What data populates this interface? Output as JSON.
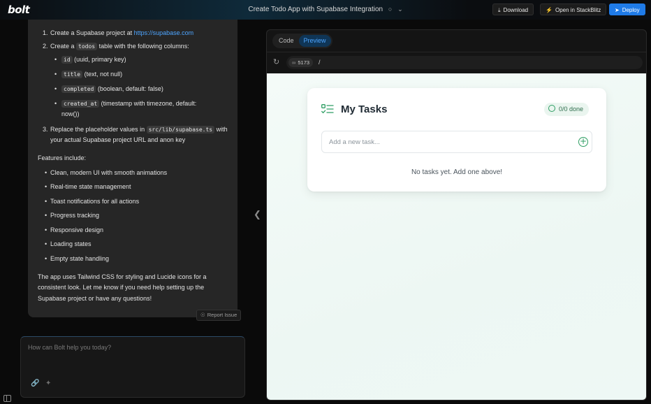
{
  "app": {
    "logo": "bolt",
    "project_title": "Create Todo App with Supabase Integration"
  },
  "toolbar": {
    "download": "Download",
    "stackblitz": "Open in StackBlitz",
    "deploy": "Deploy"
  },
  "chat": {
    "steps": [
      {
        "num": "1.",
        "pre": "Create a Supabase project at ",
        "link": "https://supabase.com"
      },
      {
        "num": "2.",
        "pre": "Create a ",
        "code": "todos",
        "post": " table with the following columns:"
      },
      {
        "num": "3.",
        "pre": "Replace the placeholder values in ",
        "code": "src/lib/supabase.ts",
        "post": " with your actual Supabase project URL and anon key"
      }
    ],
    "columns": [
      {
        "code": "id",
        "desc": " (uuid, primary key)"
      },
      {
        "code": "title",
        "desc": " (text, not null)"
      },
      {
        "code": "completed",
        "desc": " (boolean, default: false)"
      },
      {
        "code": "created_at",
        "desc": " (timestamp with timezone, default: now())"
      }
    ],
    "features_heading": "Features include:",
    "features": [
      "Clean, modern UI with smooth animations",
      "Real-time state management",
      "Toast notifications for all actions",
      "Progress tracking",
      "Responsive design",
      "Loading states",
      "Empty state handling"
    ],
    "closing": "The app uses Tailwind CSS for styling and Lucide icons for a consistent look. Let me know if you need help setting up the Supabase project or have any questions!",
    "report_issue": "Report Issue"
  },
  "prompt": {
    "placeholder": "How can Bolt help you today?"
  },
  "workbench": {
    "tabs": [
      {
        "label": "Code"
      },
      {
        "label": "Preview"
      }
    ],
    "port": "5173",
    "path": "/"
  },
  "preview": {
    "title": "My Tasks",
    "done_badge": "0/0 done",
    "input_placeholder": "Add a new task...",
    "empty_message": "No tasks yet. Add one above!"
  },
  "colors": {
    "accent": "#1f7be8",
    "success": "#2e9e63"
  }
}
